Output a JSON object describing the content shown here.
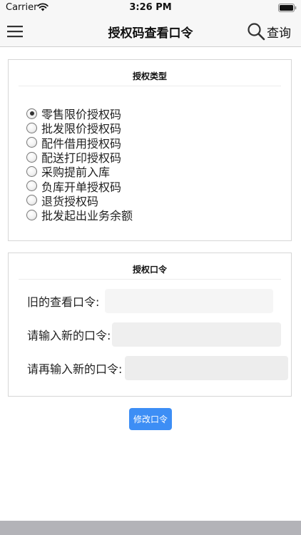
{
  "status_bar": {
    "carrier": "Carrier",
    "time": "3:26 PM"
  },
  "nav": {
    "title": "授权码查看口令",
    "query_label": "查询"
  },
  "auth_type": {
    "header": "授权类型",
    "options": [
      {
        "label": "零售限价授权码",
        "checked": true
      },
      {
        "label": "批发限价授权码",
        "checked": false
      },
      {
        "label": "配件借用授权码",
        "checked": false
      },
      {
        "label": "配送打印授权码",
        "checked": false
      },
      {
        "label": "采购提前入库",
        "checked": false
      },
      {
        "label": "负库开单授权码",
        "checked": false
      },
      {
        "label": "退货授权码",
        "checked": false
      },
      {
        "label": "批发起出业务余额",
        "checked": false
      }
    ]
  },
  "password": {
    "header": "授权口令",
    "old_label": "旧的查看口令:",
    "old_value": "",
    "new_label": "请输入新的口令:",
    "new_value": "",
    "confirm_label": "请再输入新的口令:",
    "confirm_value": ""
  },
  "actions": {
    "submit_label": "修改口令"
  },
  "colors": {
    "accent": "#3d8ef5",
    "bar_background": "#f7f7f7"
  }
}
